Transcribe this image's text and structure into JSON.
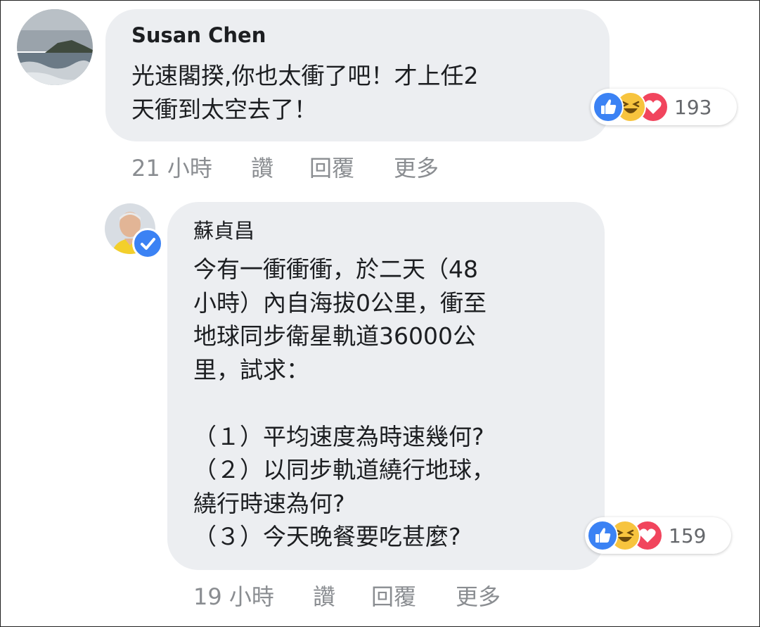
{
  "comments": [
    {
      "author": "Susan Chen",
      "text": "光速閣揆,你也太衝了吧！才上任2\n天衝到太空去了！",
      "reaction_count": "193",
      "reactions": [
        "like-icon",
        "haha-icon",
        "love-icon"
      ],
      "time": "21 小時",
      "like_label": "讚",
      "reply_label": "回覆",
      "more_label": "更多"
    },
    {
      "author": "蘇貞昌",
      "verified": true,
      "text": "今有一衝衝衝，於二天（48\n小時）內自海拔0公里，衝至\n地球同步衛星軌道36000公\n里，試求：\n\n（１）平均速度為時速幾何?\n（２）以同步軌道繞行地球，\n繞行時速為何?\n（３）今天晚餐要吃甚麼?",
      "reaction_count": "159",
      "reactions": [
        "like-icon",
        "haha-icon",
        "love-icon"
      ],
      "time": "19 小時",
      "like_label": "讚",
      "reply_label": "回覆",
      "more_label": "更多"
    }
  ],
  "colors": {
    "bubble": "#eceef1",
    "like": "#3b82f4",
    "haha": "#f7c43e",
    "love": "#f1455d",
    "meta_text": "#8a8d91"
  }
}
